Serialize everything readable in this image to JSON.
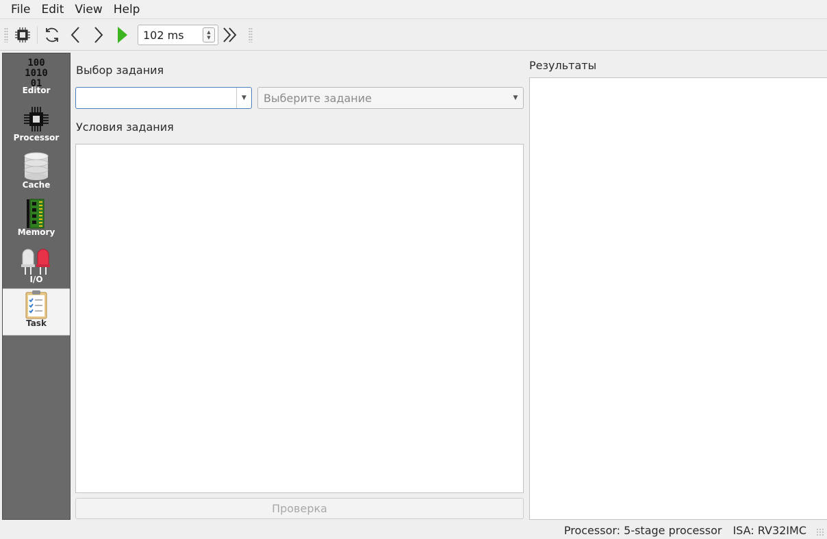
{
  "menu": {
    "items": [
      "File",
      "Edit",
      "View",
      "Help"
    ]
  },
  "toolbar": {
    "speed_value": "102 ms",
    "icons": [
      "processor-icon",
      "reset-icon",
      "step-back-icon",
      "step-forward-icon",
      "run-icon",
      "fast-forward-icon"
    ],
    "run_color": "#3cb521"
  },
  "sidebar": {
    "tabs": [
      {
        "label": "Editor",
        "icon": "binary-editor-icon"
      },
      {
        "label": "Processor",
        "icon": "chip-icon"
      },
      {
        "label": "Cache",
        "icon": "database-icon"
      },
      {
        "label": "Memory",
        "icon": "ram-module-icon"
      },
      {
        "label": "I/O",
        "icon": "led-icon"
      },
      {
        "label": "Task",
        "icon": "clipboard-checklist-icon"
      }
    ],
    "active": "Task"
  },
  "task": {
    "select_label": "Выбор задания",
    "task_combo_value": "",
    "task_combo_placeholder": "Выберите задание",
    "conditions_label": "Условия задания",
    "check_button": "Проверка",
    "results_label": "Результаты"
  },
  "status": {
    "processor": "Processor: 5-stage processor",
    "isa": "ISA: RV32IMC"
  }
}
